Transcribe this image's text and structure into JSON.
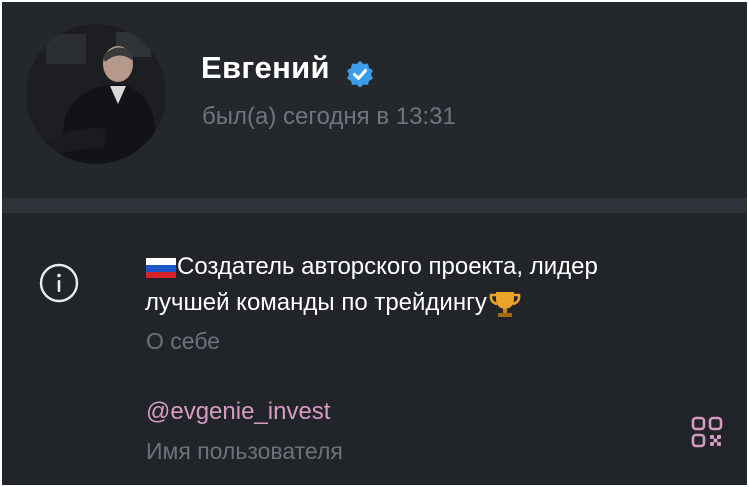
{
  "profile": {
    "name": "Евгений",
    "status": "был(а) сегодня в 13:31",
    "verified_color": "#3c9ee8",
    "avatar_icon": "profile-photo"
  },
  "info": {
    "bio_icon": "info-icon",
    "bio_line1": "Создатель авторского проекта, лидер",
    "bio_line2": "лучшей команды по трейдингу",
    "bio_label": "О себе",
    "username": "@evgenie_invest",
    "username_label": "Имя пользователя",
    "username_color": "#d69bc4",
    "qr_icon": "qr-code-icon"
  }
}
